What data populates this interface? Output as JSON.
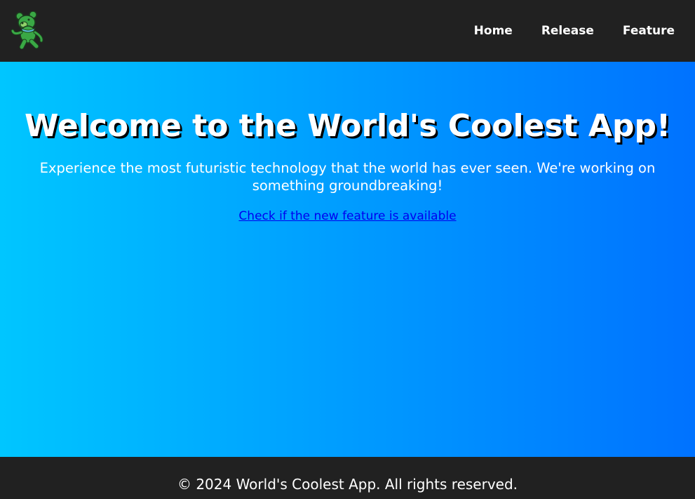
{
  "navbar": {
    "logo_icon": "dancing-bear-icon",
    "links": [
      {
        "label": "Home"
      },
      {
        "label": "Release"
      },
      {
        "label": "Feature"
      }
    ]
  },
  "hero": {
    "title": "Welcome to the World's Coolest App!",
    "subtitle": "Experience the most futuristic technology that the world has ever seen. We're working on something groundbreaking!",
    "link_label": "Check if the new feature is available",
    "gradient_start": "#00c6ff",
    "gradient_end": "#0072ff"
  },
  "footer": {
    "text": "© 2024 World's Coolest App. All rights reserved."
  },
  "colors": {
    "nav_bg": "#212121",
    "link": "#0000ee",
    "text": "#ffffff"
  }
}
